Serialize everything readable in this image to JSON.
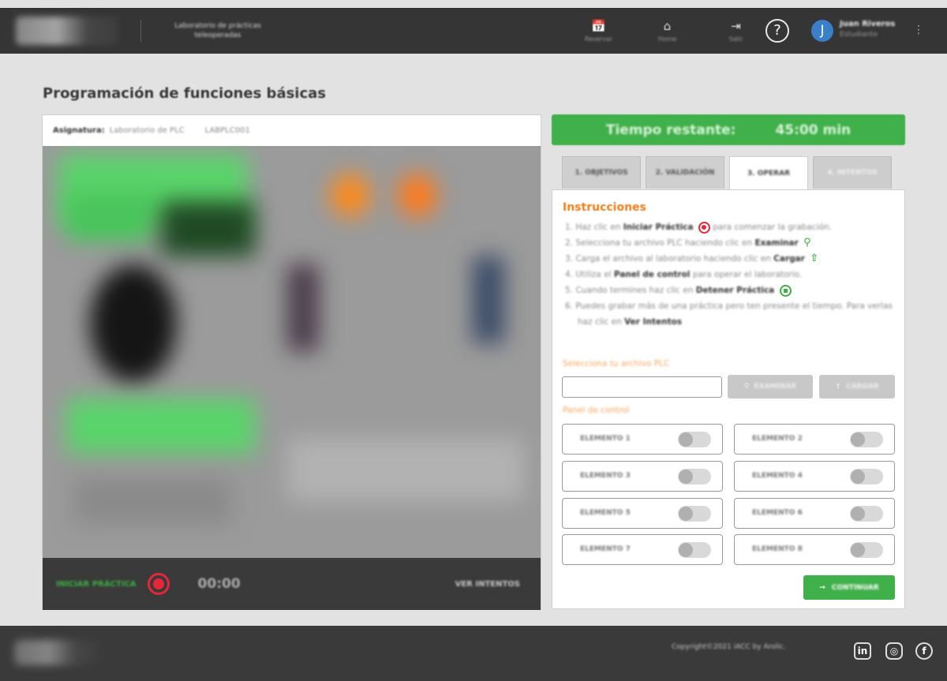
{
  "header": {
    "app_title": "Laboratorio de prácticas teleoperadas",
    "nav": [
      {
        "label": "Reservar",
        "icon": "calendar-icon",
        "glyph": "📅"
      },
      {
        "label": "Home",
        "icon": "home-icon",
        "glyph": "⌂"
      },
      {
        "label": "Salir",
        "icon": "logout-icon",
        "glyph": "⇥"
      }
    ],
    "help_glyph": "?",
    "user": {
      "initial": "J",
      "name": "Juan Riveros",
      "role": "Estudiante"
    },
    "menu_glyph": "⋮"
  },
  "page": {
    "title": "Programación de funciones básicas"
  },
  "subject": {
    "key": "Asignatura:",
    "name": "Laboratorio de PLC",
    "code": "LABPLC001"
  },
  "video_bar": {
    "start_label": "INICIAR PRÁCTICA",
    "timer": "00:00",
    "attempts_label": "VER INTENTOS"
  },
  "time_remaining": {
    "label": "Tiempo restante:",
    "value": "45:00 min"
  },
  "tabs": [
    {
      "label": "1. OBJETIVOS",
      "state": "normal"
    },
    {
      "label": "2. VALIDACIÓN",
      "state": "normal"
    },
    {
      "label": "3. OPERAR",
      "state": "active"
    },
    {
      "label": "4. INTENTOS",
      "state": "disabled"
    }
  ],
  "instructions": {
    "title": "Instrucciones",
    "steps": [
      {
        "pre": "1. Haz clic en ",
        "bold": "Iniciar Práctica",
        "post": " para comenzar la grabación.",
        "icon": "record-icon",
        "icon_pos": "mid"
      },
      {
        "pre": "2. Selecciona tu archivo PLC haciendo clic en ",
        "bold": "Examinar",
        "post": "",
        "icon": "search-icon",
        "icon_pos": "end"
      },
      {
        "pre": "3. Carga el archivo al laboratorio haciendo clic en ",
        "bold": "Cargar",
        "post": "",
        "icon": "upload-icon",
        "icon_pos": "end"
      },
      {
        "pre": "4. Utiliza el ",
        "bold": "Panel de control",
        "post": " para operar el laboratorio.",
        "icon": "",
        "icon_pos": ""
      },
      {
        "pre": "5. Cuando termines haz clic en ",
        "bold": "Detener Práctica",
        "post": "",
        "icon": "stop-icon",
        "icon_pos": "end"
      },
      {
        "pre": "6. Puedes grabar más de una práctica pero ten presente el tiempo. Para verlas haz clic en ",
        "bold": "Ver Intentos",
        "post": "",
        "icon": "",
        "icon_pos": ""
      }
    ]
  },
  "file": {
    "label": "Selecciona tu archivo PLC",
    "value": "",
    "browse_label": "EXAMINAR",
    "upload_label": "CARGAR"
  },
  "control_panel": {
    "label": "Panel de control",
    "elements": [
      {
        "label": "ELEMENTO 1",
        "on": false
      },
      {
        "label": "ELEMENTO 2",
        "on": false
      },
      {
        "label": "ELEMENTO 3",
        "on": false
      },
      {
        "label": "ELEMENTO 4",
        "on": false
      },
      {
        "label": "ELEMENTO 5",
        "on": false
      },
      {
        "label": "ELEMENTO 6",
        "on": false
      },
      {
        "label": "ELEMENTO 7",
        "on": false
      },
      {
        "label": "ELEMENTO 8",
        "on": false
      }
    ]
  },
  "continue_label": "CONTINUAR",
  "footer": {
    "copyright": "Copyright©2021 iACC by Arolic."
  },
  "colors": {
    "accent_green": "#40b04a",
    "record_red": "#e8263a",
    "orange": "#ef7d17",
    "dark_bar": "#353535"
  }
}
